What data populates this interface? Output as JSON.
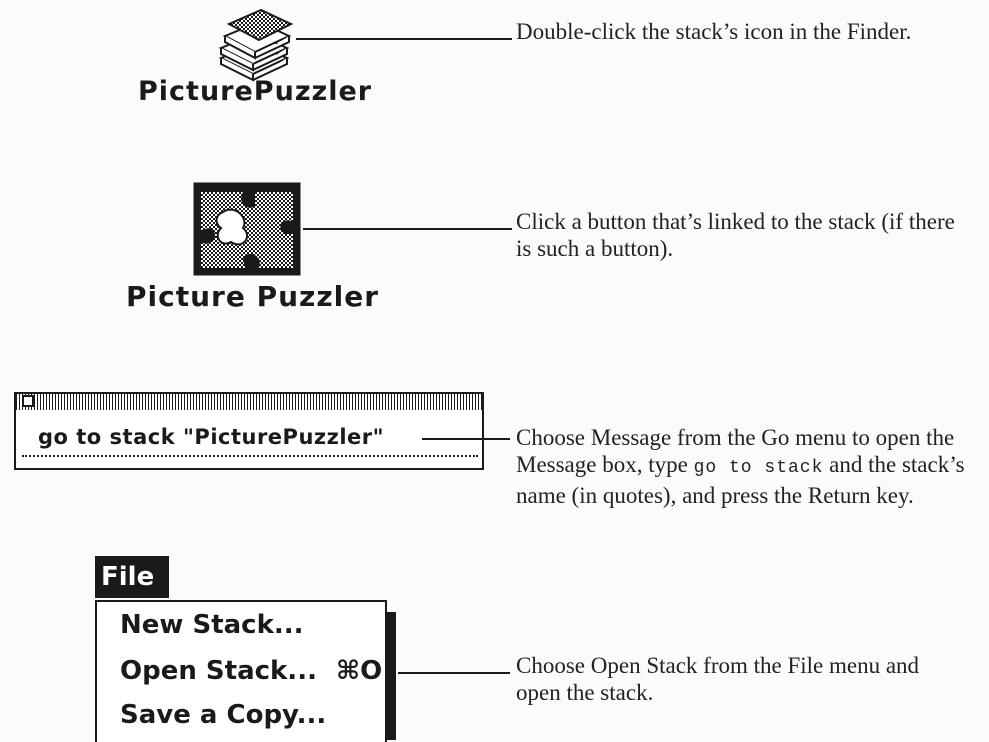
{
  "steps": [
    {
      "icon_label": "PicturePuzzler",
      "icon": "stack-icon",
      "caption": "Double-click the stack’s icon in the Finder."
    },
    {
      "icon_label": "Picture Puzzler",
      "icon": "picture-puzzle-button-icon",
      "caption": "Click a button that’s linked to the stack (if there is such a button)."
    },
    {
      "message_box_text": "go to stack \"PicturePuzzler\"",
      "caption_pre": "Choose Message from the Go menu to open the Message box, type",
      "caption_code": "go to stack",
      "caption_post": "and the stack’s name (in quotes), and press the Return key."
    },
    {
      "caption": "Choose Open Stack from the File menu and open the stack."
    }
  ],
  "file_menu": {
    "title": "File",
    "items": [
      {
        "label": "New Stack...",
        "shortcut": ""
      },
      {
        "label": "Open Stack...",
        "shortcut": "⌘O"
      },
      {
        "label": "Save a Copy...",
        "shortcut": ""
      }
    ]
  }
}
